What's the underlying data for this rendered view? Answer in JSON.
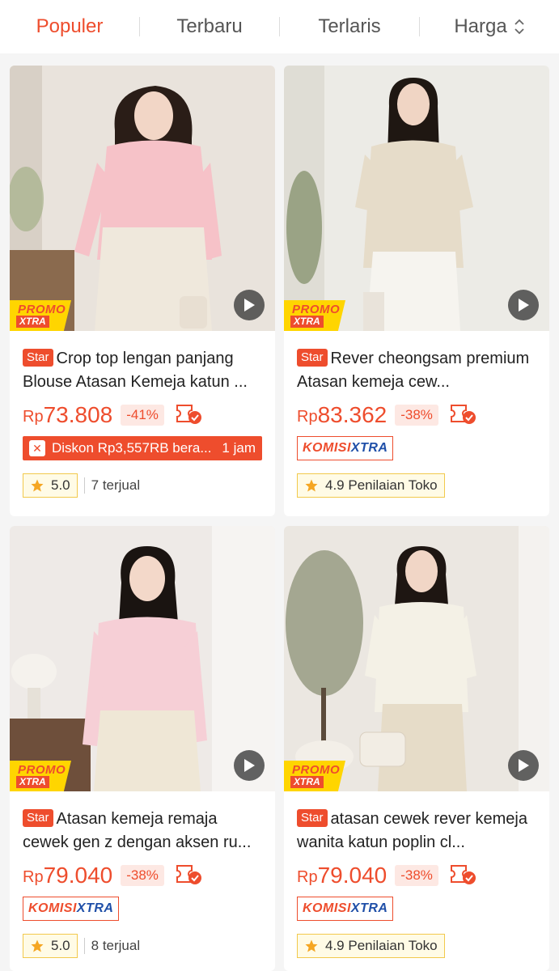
{
  "sort": {
    "tabs": [
      {
        "label": "Populer",
        "active": true
      },
      {
        "label": "Terbaru",
        "active": false
      },
      {
        "label": "Terlaris",
        "active": false
      },
      {
        "label": "Harga",
        "active": false
      }
    ]
  },
  "brand_color": "#ee4d2d",
  "common": {
    "promo_top": "PROMO",
    "promo_bottom": "XTRA",
    "star_badge": "Star",
    "currency": "Rp",
    "komisi_1": "KOMISI",
    "komisi_2": "XTRA"
  },
  "products": [
    {
      "title": "Crop top lengan panjang Blouse Atasan Kemeja katun ...",
      "price": "73.808",
      "discount": "-41%",
      "flash_text": "Diskon Rp3,557RB bera...",
      "flash_time": "1 jam",
      "rating": "5.0",
      "sold": "7 terjual"
    },
    {
      "title": "Rever cheongsam premium Atasan kemeja cew...",
      "price": "83.362",
      "discount": "-38%",
      "rating": "4.9 Penilaian Toko"
    },
    {
      "title": "Atasan kemeja remaja cewek gen z dengan aksen ru...",
      "price": "79.040",
      "discount": "-38%",
      "rating": "5.0",
      "sold": "8 terjual"
    },
    {
      "title": "atasan cewek rever kemeja wanita katun poplin cl...",
      "price": "79.040",
      "discount": "-38%",
      "rating": "4.9 Penilaian Toko"
    }
  ]
}
